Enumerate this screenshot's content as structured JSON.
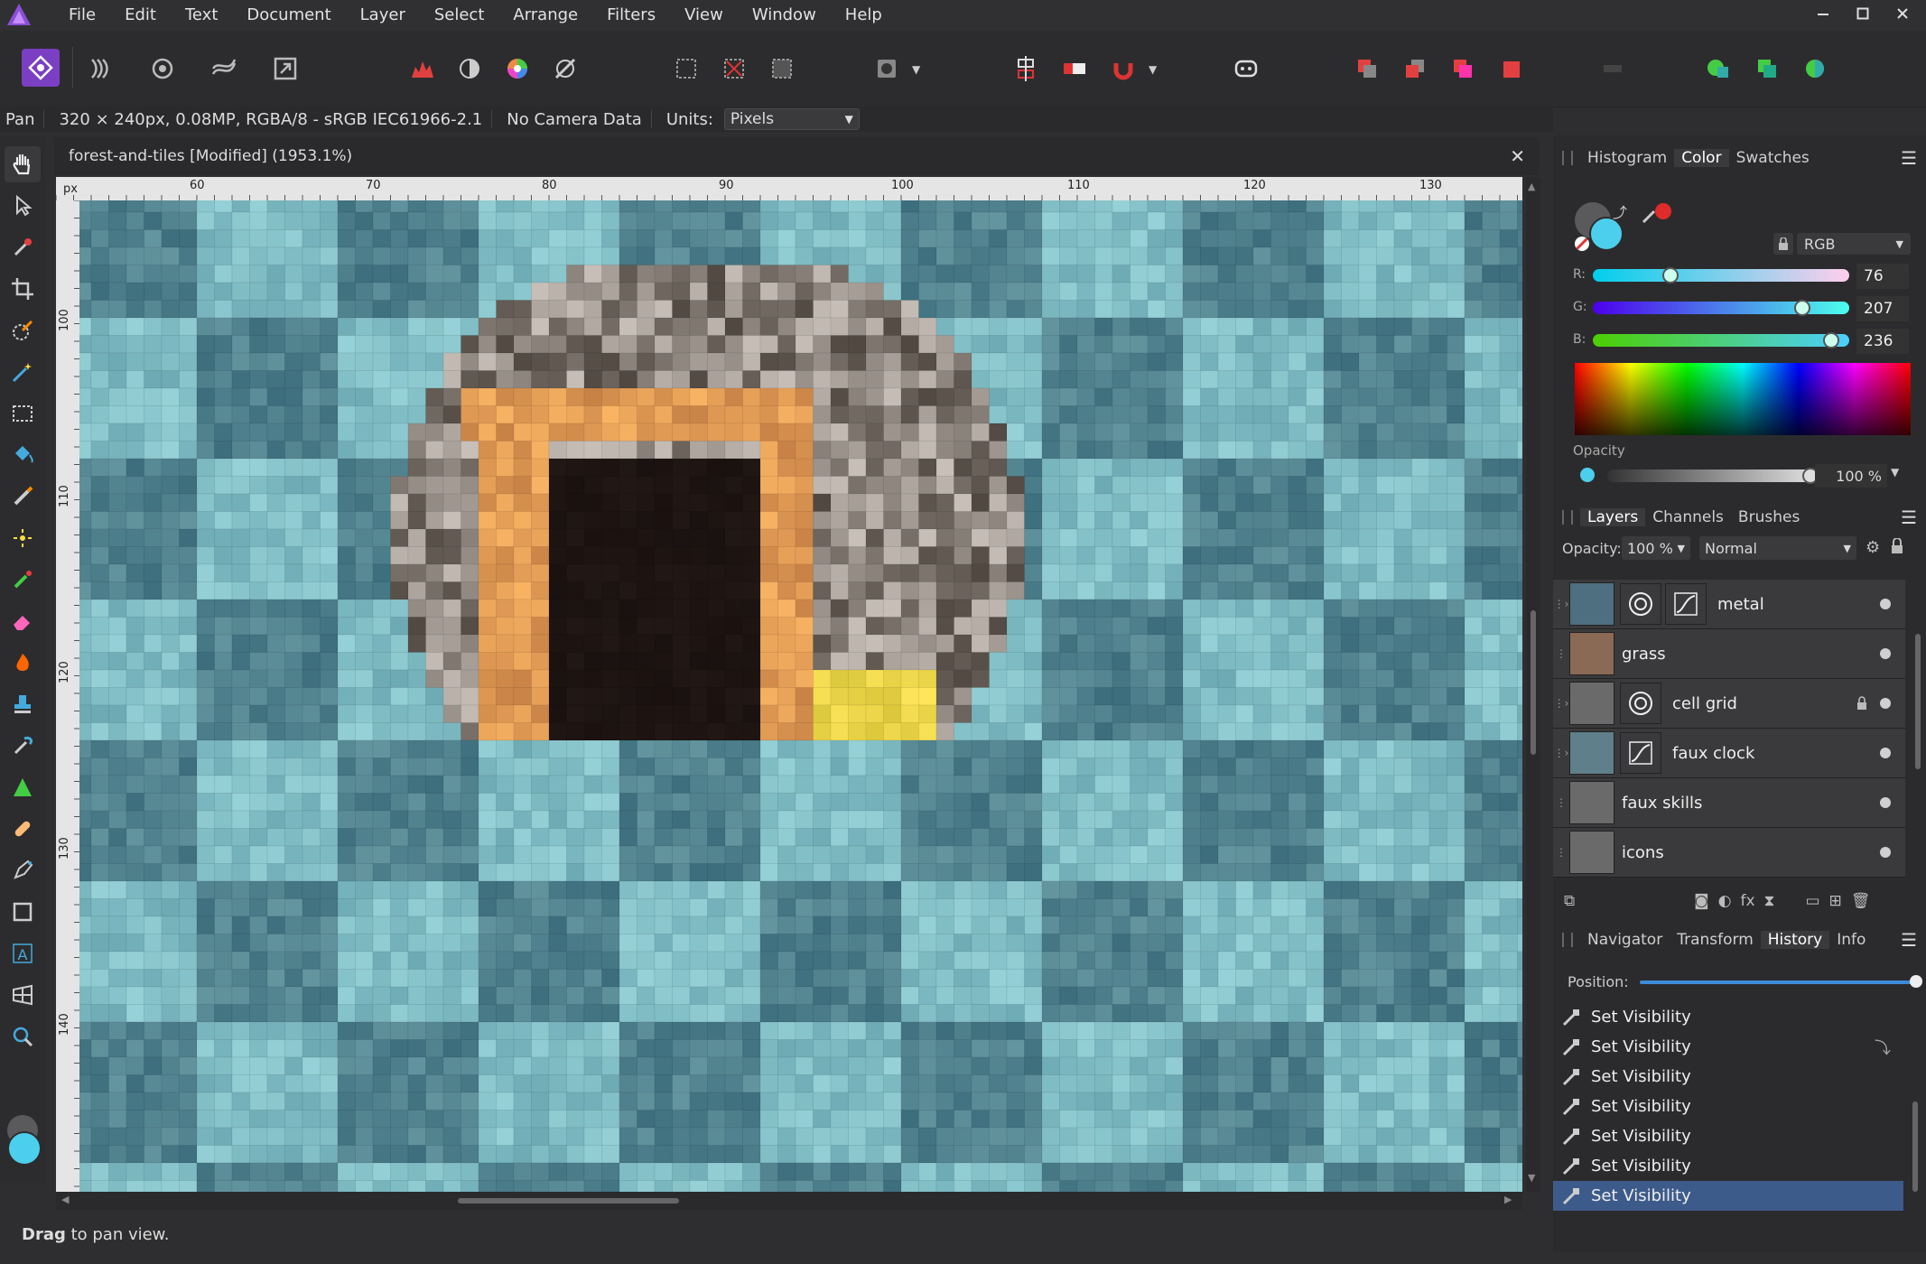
{
  "app": {
    "accent": "#7a3fc2"
  },
  "menu": {
    "items": [
      "File",
      "Edit",
      "Text",
      "Document",
      "Layer",
      "Select",
      "Arrange",
      "Filters",
      "View",
      "Window",
      "Help"
    ]
  },
  "context": {
    "tool": "Pan",
    "doc_info": "320 × 240px, 0.08MP, RGBA/8 - sRGB IEC61966-2.1",
    "camera": "No Camera Data",
    "units_label": "Units:",
    "units_value": "Pixels"
  },
  "document": {
    "tab_title": "forest-and-tiles [Modified] (1953.1%)"
  },
  "ruler": {
    "unit": "px",
    "top_ticks": [
      "60",
      "70",
      "80",
      "90",
      "100",
      "110",
      "120",
      "130"
    ],
    "left_ticks": [
      "100",
      "110",
      "120",
      "130",
      "140"
    ]
  },
  "status": {
    "bold": "Drag",
    "rest": " to pan view."
  },
  "color_panel": {
    "tabs": [
      "Histogram",
      "Color",
      "Swatches"
    ],
    "active_tab": "Color",
    "mode": "RGB",
    "channels": [
      {
        "label": "R:",
        "value": 76,
        "max": 255
      },
      {
        "label": "G:",
        "value": 207,
        "max": 255
      },
      {
        "label": "B:",
        "value": 236,
        "max": 255
      }
    ],
    "current_color": "#4ccfec",
    "opacity_label": "Opacity",
    "opacity_value": "100 %"
  },
  "layers_panel": {
    "tabs": [
      "Layers",
      "Channels",
      "Brushes"
    ],
    "active_tab": "Layers",
    "opacity_label": "Opacity:",
    "opacity_value": "100 %",
    "blend_mode": "Normal",
    "layers": [
      {
        "name": "metal",
        "fx": [
          "circle-adjust-icon",
          "curves-icon"
        ],
        "locked": false
      },
      {
        "name": "grass",
        "fx": [],
        "locked": false
      },
      {
        "name": "cell grid",
        "fx": [
          "circle-adjust-icon"
        ],
        "locked": true
      },
      {
        "name": "faux clock",
        "fx": [
          "curves-icon"
        ],
        "locked": false
      },
      {
        "name": "faux skills",
        "fx": [],
        "locked": false
      },
      {
        "name": "icons",
        "fx": [],
        "locked": false
      }
    ]
  },
  "history_panel": {
    "tabs": [
      "Navigator",
      "Transform",
      "History",
      "Info"
    ],
    "active_tab": "History",
    "position_label": "Position:",
    "position_fraction": 1.0,
    "entries": [
      "Set Visibility",
      "Set Visibility",
      "Set Visibility",
      "Set Visibility",
      "Set Visibility",
      "Set Visibility",
      "Set Visibility"
    ],
    "selected_index": 6
  }
}
